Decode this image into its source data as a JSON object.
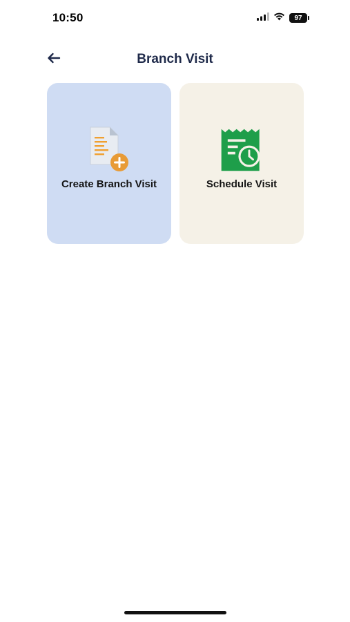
{
  "status_bar": {
    "time": "10:50",
    "battery": "97",
    "icons": [
      "signal-icon",
      "wifi-icon",
      "battery-icon"
    ]
  },
  "header": {
    "title": "Branch Visit",
    "back_icon": "arrow-left-icon"
  },
  "cards": [
    {
      "label": "Create Branch Visit",
      "icon": "document-add-icon",
      "background": "#cfdcf3",
      "icon_colors": {
        "doc": "#e8ecf2",
        "lines": "#f0a030",
        "badge": "#e89b36"
      }
    },
    {
      "label": "Schedule Visit",
      "icon": "receipt-clock-icon",
      "background": "#f5f1e7",
      "icon_color": "#1e9e4a"
    }
  ],
  "colors": {
    "title": "#1f2a4a",
    "background": "#ffffff"
  }
}
